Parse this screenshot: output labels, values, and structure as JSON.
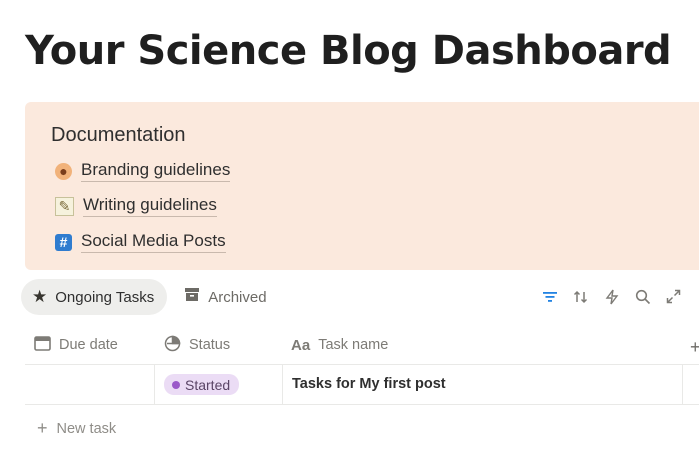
{
  "page": {
    "title": "Your Science Blog Dashboard"
  },
  "callout": {
    "title": "Documentation",
    "links": [
      {
        "label": "Branding guidelines",
        "icon": "palette-emoji-icon"
      },
      {
        "label": "Writing guidelines",
        "icon": "memo-emoji-icon"
      },
      {
        "label": "Social Media Posts",
        "icon": "hash-emoji-icon"
      }
    ],
    "background": "#fbe9dd"
  },
  "views": {
    "tabs": [
      {
        "label": "Ongoing Tasks",
        "icon": "star-icon",
        "active": true
      },
      {
        "label": "Archived",
        "icon": "archive-icon",
        "active": false
      }
    ]
  },
  "toolbar": {
    "icons": [
      "filter-icon",
      "sort-icon",
      "automation-icon",
      "search-icon",
      "expand-icon"
    ],
    "accent": "#2383e2"
  },
  "table": {
    "columns": [
      {
        "label": "Due date",
        "icon": "calendar-icon"
      },
      {
        "label": "Status",
        "icon": "status-icon"
      },
      {
        "label": "Task name",
        "icon": "text-property-icon"
      }
    ],
    "rows": [
      {
        "due_date": "",
        "status": "Started",
        "status_color": "#9b59c9",
        "task_name": "Tasks for My first post"
      }
    ],
    "new_task_label": "New task"
  }
}
